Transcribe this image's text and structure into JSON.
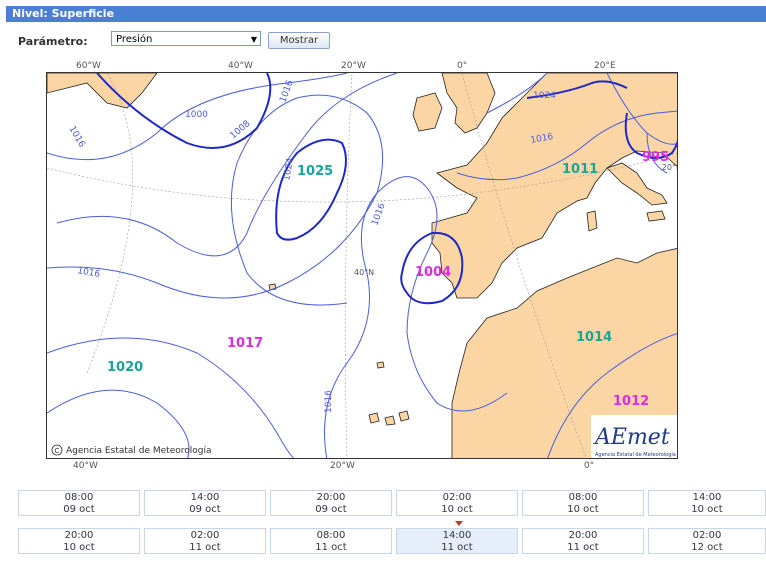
{
  "header": {
    "title": "Nivel: Superficie"
  },
  "form": {
    "param_label": "Parámetro:",
    "param_selected": "Presión",
    "submit_label": "Mostrar"
  },
  "map": {
    "top_labels": [
      "60°W",
      "40°W",
      "20°W",
      "0°",
      "20°E"
    ],
    "bottom_labels": [
      "40°W",
      "20°W",
      "0°"
    ],
    "inner_labels": {
      "lat": "40°N",
      "right": "20°E"
    },
    "pressure_labels": [
      {
        "text": "1025",
        "color": "#1aa39a"
      },
      {
        "text": "1011",
        "color": "#1aa39a"
      },
      {
        "text": "995",
        "color": "#e02ae0"
      },
      {
        "text": "1004",
        "color": "#e02ae0"
      },
      {
        "text": "1017",
        "color": "#e02ae0"
      },
      {
        "text": "1014",
        "color": "#1aa39a"
      },
      {
        "text": "1020",
        "color": "#1aa39a"
      },
      {
        "text": "1012",
        "color": "#e02ae0"
      }
    ],
    "isobar_labels": [
      "1016",
      "1000",
      "1008",
      "1016",
      "1024",
      "1016",
      "1016",
      "1016",
      "1024",
      "1016"
    ],
    "copyright": "Agencia Estatal de Meteorología",
    "logo_text": "AEmet",
    "logo_sub": "Agencia Estatal de Meteorología"
  },
  "times": {
    "row1": [
      {
        "time": "08:00",
        "date": "09 oct"
      },
      {
        "time": "14:00",
        "date": "09 oct"
      },
      {
        "time": "20:00",
        "date": "09 oct"
      },
      {
        "time": "02:00",
        "date": "10 oct"
      },
      {
        "time": "08:00",
        "date": "10 oct"
      },
      {
        "time": "14:00",
        "date": "10 oct"
      }
    ],
    "row2": [
      {
        "time": "20:00",
        "date": "10 oct"
      },
      {
        "time": "02:00",
        "date": "11 oct"
      },
      {
        "time": "08:00",
        "date": "11 oct"
      },
      {
        "time": "14:00",
        "date": "11 oct"
      },
      {
        "time": "20:00",
        "date": "11 oct"
      },
      {
        "time": "02:00",
        "date": "12 oct"
      }
    ],
    "selected": "14:00 11 oct"
  }
}
